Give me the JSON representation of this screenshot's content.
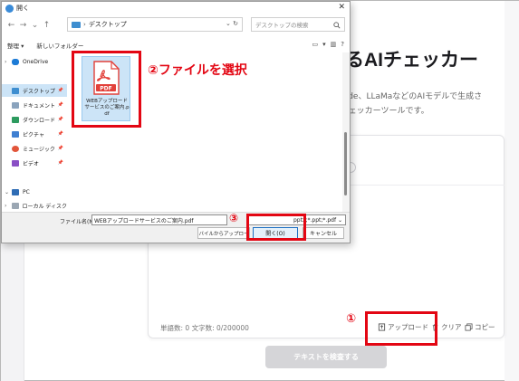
{
  "background_page": {
    "heading": "るAIチェッカー",
    "description_lines": [
      "aude、LLaMaなどのAIモデルで生成さ",
      "Iチェッカーツールです。"
    ],
    "word_count_text": "単語数: 0   文字数: 0/200000",
    "upload_label": "アップロード",
    "clear_label": "クリア",
    "copy_label": "コピー",
    "check_button_label": "テキストを検査する"
  },
  "dialog": {
    "title": "開く",
    "close_glyph": "✕",
    "nav": {
      "back": "←",
      "forward": "→",
      "dropdown": "⌄",
      "up": "↑"
    },
    "address": {
      "separator": "›",
      "folder": "デスクトップ",
      "dropdown": "⌄",
      "refresh": "↻"
    },
    "search_placeholder": "デスクトップの検索",
    "commands": {
      "organize": "整理 ▾",
      "new_folder": "新しいフォルダー"
    },
    "view_controls": [
      "▭",
      "▾",
      "▥",
      "?"
    ],
    "nav_pane": {
      "items": [
        {
          "label": "OneDrive",
          "chevron": "›",
          "pin": ""
        },
        {
          "label": "デスクトップ",
          "chevron": "",
          "pin": "📌"
        },
        {
          "label": "ドキュメント",
          "chevron": "",
          "pin": "📌"
        },
        {
          "label": "ダウンロード",
          "chevron": "",
          "pin": "📌"
        },
        {
          "label": "ピクチャ",
          "chevron": "",
          "pin": "📌"
        },
        {
          "label": "ミュージック",
          "chevron": "",
          "pin": "📌"
        },
        {
          "label": "ビデオ",
          "chevron": "",
          "pin": "📌"
        },
        {
          "label": "PC",
          "chevron": "⌄",
          "pin": ""
        },
        {
          "label": "ローカル ディスク",
          "chevron": "›",
          "pin": ""
        }
      ]
    },
    "file": {
      "name": "WEBアップロードサービスのご案内.pdf",
      "icon_text": "PDF"
    },
    "filename_label": "ファイル名(N):",
    "filename_value": "WEBアップロードサービスのご案内.pdf",
    "filetype_value": "pptx;*.ppt;*.pdf ⌄",
    "mobile_upload_label": "モバイルからアップロード",
    "open_label": "開く(O)",
    "cancel_label": "キャンセル"
  },
  "annotations": {
    "step1": "①",
    "step2": "②ファイルを選択",
    "step3": "③"
  },
  "colors": {
    "annotation_red": "#e30613",
    "selection_blue": "#cce4f7",
    "pdf_red": "#e2403a",
    "folder_blue": "#3e8ed0"
  }
}
